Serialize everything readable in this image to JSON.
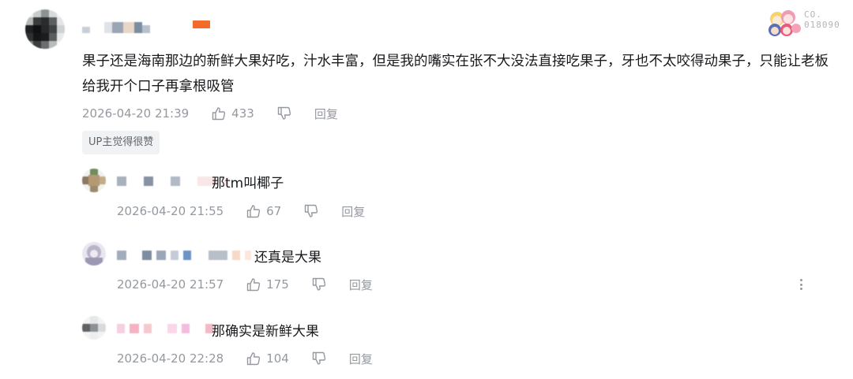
{
  "main_comment": {
    "text": "果子还是海南那边的新鲜大果好吃，汁水丰富，但是我的嘴实在张不大没法直接吃果子，牙也不太咬得动果子，只能让老板给我开个口子再拿根吸管",
    "time": "2026-04-20 21:39",
    "likes": "433",
    "reply_label": "回复",
    "up_badge": "UP主觉得很赞",
    "decoration_number": "CO.\n018090",
    "level_color": "#f26b2b"
  },
  "replies": [
    {
      "text": "那tm叫椰子",
      "time": "2026-04-20 21:55",
      "likes": "67",
      "reply_label": "回复"
    },
    {
      "text": "还真是大果",
      "time": "2026-04-20 21:57",
      "likes": "175",
      "reply_label": "回复"
    },
    {
      "text": "那确实是新鲜大果",
      "time": "2026-04-20 22:28",
      "likes": "104",
      "reply_label": "回复"
    }
  ],
  "icons": {
    "like": "thumbs-up-icon",
    "dislike": "thumbs-down-icon",
    "more": "more-vertical-icon"
  }
}
